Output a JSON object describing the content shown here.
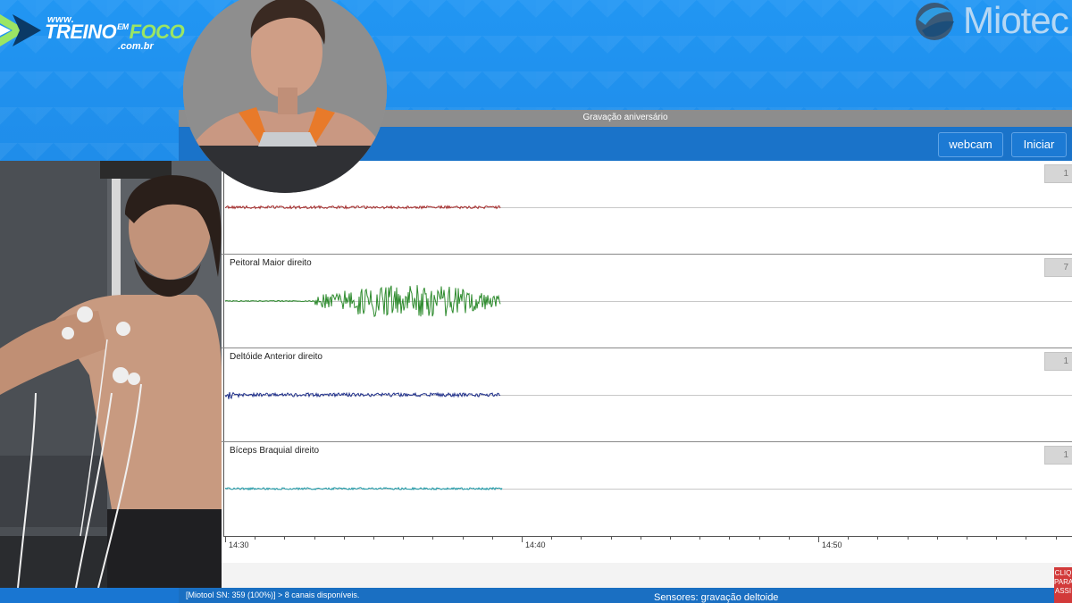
{
  "brand": {
    "url_top": "www.",
    "url_main_a": "TREINO",
    "url_main_em": "EM",
    "url_main_b": "FOCO",
    "url_sub": ".com.br",
    "accent": "#9be564"
  },
  "miotec_logo": {
    "text": "Miotec"
  },
  "app": {
    "title": "Gravação aniversário",
    "toolbar": {
      "webcam_label": "webcam",
      "iniciar_label": "Iniciar"
    },
    "channels": [
      {
        "label": "",
        "color": "#a52a2a",
        "scale": "1"
      },
      {
        "label": "Peitoral Maior direito",
        "color": "#2e8b2e",
        "scale": "7"
      },
      {
        "label": "Deltóide Anterior direito",
        "color": "#1f2f8a",
        "scale": "1"
      },
      {
        "label": "Bíceps Braquial direito",
        "color": "#1f9aa8",
        "scale": "1"
      }
    ],
    "x_ticks": [
      "14:30",
      "14:40",
      "14:50"
    ],
    "status_left": "[Miotool SN: 359 (100%)] > 8 canais disponíveis.",
    "status_center": "Sensores: gravação deltoide",
    "side_tab": "CLIQ PARA ASSI"
  },
  "colors": {
    "background": "#1e88e5",
    "toolbar": "#1a73c9",
    "titlebar": "#8d8d8d"
  },
  "icons": {
    "brand": "chevron-logo-icon",
    "miotec": "miotec-globe-icon"
  }
}
